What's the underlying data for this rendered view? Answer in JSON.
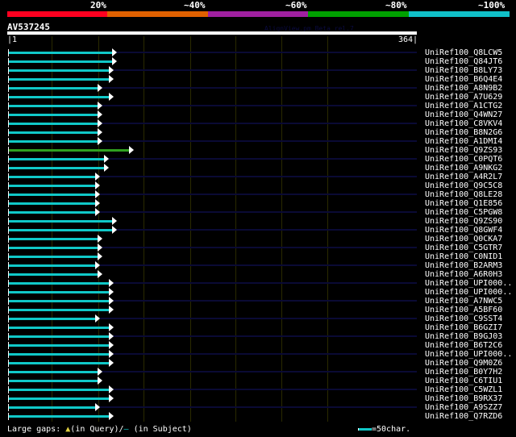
{
  "header": {
    "percent_labels": [
      "20%",
      "~40%",
      "~60%",
      "~80%",
      "~100%"
    ],
    "color_scale": [
      "#ff0020",
      "#e06000",
      "#a020a0",
      "#00a000",
      "#10c0c8"
    ],
    "query_id": "AV537245",
    "version": "AlignView.pm Beta rel.7",
    "start": "|1",
    "end": "364|"
  },
  "query_length": 364,
  "hits": [
    {
      "name": "UniRef100_Q8LCW5",
      "end": 97,
      "color": "#10c8c8"
    },
    {
      "name": "UniRef100_Q84JT6",
      "end": 97,
      "color": "#10c8c8"
    },
    {
      "name": "UniRef100_B8LY73",
      "end": 94,
      "color": "#10c8c8"
    },
    {
      "name": "UniRef100_B6Q4E4",
      "end": 94,
      "color": "#10c8c8"
    },
    {
      "name": "UniRef100_A8N9B2",
      "end": 84,
      "color": "#10c8c8"
    },
    {
      "name": "UniRef100_A7U629",
      "end": 94,
      "color": "#10c8c8"
    },
    {
      "name": "UniRef100_A1CTG2",
      "end": 84,
      "color": "#10c8c8"
    },
    {
      "name": "UniRef100_Q4WN27",
      "end": 84,
      "color": "#10c8c8"
    },
    {
      "name": "UniRef100_C8VKV4",
      "end": 84,
      "color": "#10c8c8"
    },
    {
      "name": "UniRef100_B8N2G6",
      "end": 84,
      "color": "#10c8c8"
    },
    {
      "name": "UniRef100_A1DMI4",
      "end": 84,
      "color": "#10c8c8"
    },
    {
      "name": "UniRef100_Q9ZS93",
      "end": 112,
      "color": "#30a020"
    },
    {
      "name": "UniRef100_C0PQT6",
      "end": 90,
      "color": "#10c8c8"
    },
    {
      "name": "UniRef100_A9NKG2",
      "end": 90,
      "color": "#10c8c8"
    },
    {
      "name": "UniRef100_A4R2L7",
      "end": 82,
      "color": "#10c8c8"
    },
    {
      "name": "UniRef100_Q9C5C8",
      "end": 82,
      "color": "#10c8c8"
    },
    {
      "name": "UniRef100_Q8LE28",
      "end": 82,
      "color": "#10c8c8"
    },
    {
      "name": "UniRef100_Q1E856",
      "end": 82,
      "color": "#10c8c8"
    },
    {
      "name": "UniRef100_C5PGW8",
      "end": 82,
      "color": "#10c8c8"
    },
    {
      "name": "UniRef100_Q9ZS90",
      "end": 97,
      "color": "#10c8c8"
    },
    {
      "name": "UniRef100_Q8GWF4",
      "end": 97,
      "color": "#10c8c8"
    },
    {
      "name": "UniRef100_Q0CKA7",
      "end": 84,
      "color": "#10c8c8"
    },
    {
      "name": "UniRef100_C5GTR7",
      "end": 84,
      "color": "#10c8c8"
    },
    {
      "name": "UniRef100_C0NID1",
      "end": 84,
      "color": "#10c8c8"
    },
    {
      "name": "UniRef100_B2ARM3",
      "end": 82,
      "color": "#10c8c8"
    },
    {
      "name": "UniRef100_A6R0H3",
      "end": 84,
      "color": "#10c8c8"
    },
    {
      "name": "UniRef100_UPI000..",
      "end": 94,
      "color": "#10c8c8"
    },
    {
      "name": "UniRef100_UPI000..",
      "end": 94,
      "color": "#10c8c8"
    },
    {
      "name": "UniRef100_A7NWC5",
      "end": 94,
      "color": "#10c8c8"
    },
    {
      "name": "UniRef100_A5BF60",
      "end": 94,
      "color": "#10c8c8"
    },
    {
      "name": "UniRef100_C9SST4",
      "end": 82,
      "color": "#10c8c8"
    },
    {
      "name": "UniRef100_B6GZI7",
      "end": 94,
      "color": "#10c8c8"
    },
    {
      "name": "UniRef100_B9GJ03",
      "end": 94,
      "color": "#10c8c8"
    },
    {
      "name": "UniRef100_B6T2C6",
      "end": 94,
      "color": "#10c8c8"
    },
    {
      "name": "UniRef100_UPI000..",
      "end": 94,
      "color": "#10c8c8"
    },
    {
      "name": "UniRef100_Q9M0Z6",
      "end": 94,
      "color": "#10c8c8"
    },
    {
      "name": "UniRef100_B0Y7H2",
      "end": 84,
      "color": "#10c8c8"
    },
    {
      "name": "UniRef100_C6TIU1",
      "end": 84,
      "color": "#10c8c8"
    },
    {
      "name": "UniRef100_C5WZL1",
      "end": 94,
      "color": "#10c8c8"
    },
    {
      "name": "UniRef100_B9RX37",
      "end": 94,
      "color": "#10c8c8"
    },
    {
      "name": "UniRef100_A9SZZ7",
      "end": 82,
      "color": "#10c8c8"
    },
    {
      "name": "UniRef100_Q7RZD6",
      "end": 94,
      "color": "#10c8c8"
    }
  ],
  "footer": {
    "gaps_label": "Large gaps:",
    "query_mark": "▲",
    "query_text": "(in Query)/",
    "subject_mark": "–",
    "subject_text": " (in Subject)",
    "legend_text": "=50char."
  }
}
